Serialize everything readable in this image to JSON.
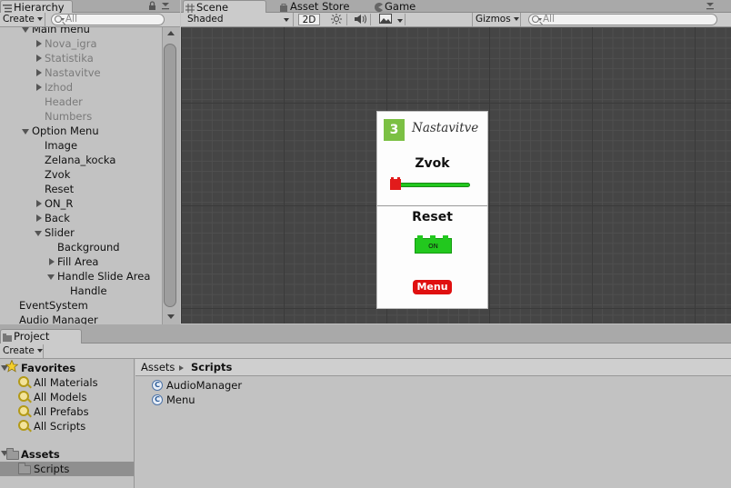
{
  "hierarchy": {
    "tab_label": "Hierarchy",
    "create_label": "Create",
    "search_placeholder": "All",
    "items": [
      {
        "label": "Main menu",
        "arrow": "down",
        "indent": 0,
        "dim": false
      },
      {
        "label": "Nova_igra",
        "arrow": "right",
        "indent": 1,
        "dim": true
      },
      {
        "label": "Statistika",
        "arrow": "right",
        "indent": 1,
        "dim": true
      },
      {
        "label": "Nastavitve",
        "arrow": "right",
        "indent": 1,
        "dim": true
      },
      {
        "label": "Izhod",
        "arrow": "right",
        "indent": 1,
        "dim": true
      },
      {
        "label": "Header",
        "arrow": "",
        "indent": 1,
        "dim": true
      },
      {
        "label": "Numbers",
        "arrow": "",
        "indent": 1,
        "dim": true
      },
      {
        "label": "Option Menu",
        "arrow": "down",
        "indent": 0,
        "dim": false
      },
      {
        "label": "Image",
        "arrow": "",
        "indent": 1,
        "dim": false
      },
      {
        "label": "Zelana_kocka",
        "arrow": "",
        "indent": 1,
        "dim": false
      },
      {
        "label": "Zvok",
        "arrow": "",
        "indent": 1,
        "dim": false
      },
      {
        "label": "Reset",
        "arrow": "",
        "indent": 1,
        "dim": false
      },
      {
        "label": "ON_R",
        "arrow": "right",
        "indent": 1,
        "dim": false
      },
      {
        "label": "Back",
        "arrow": "right",
        "indent": 1,
        "dim": false
      },
      {
        "label": "Slider",
        "arrow": "down",
        "indent": 1,
        "dim": false
      },
      {
        "label": "Background",
        "arrow": "",
        "indent": 2,
        "dim": false
      },
      {
        "label": "Fill Area",
        "arrow": "right",
        "indent": 2,
        "dim": false
      },
      {
        "label": "Handle Slide Area",
        "arrow": "down",
        "indent": 2,
        "dim": false
      },
      {
        "label": "Handle",
        "arrow": "",
        "indent": 3,
        "dim": false
      },
      {
        "label": "EventSystem",
        "arrow": "",
        "indent": -1,
        "dim": false
      },
      {
        "label": "Audio Manager",
        "arrow": "",
        "indent": -1,
        "dim": false
      }
    ]
  },
  "tabs": {
    "scene": "Scene",
    "asset_store": "Asset Store",
    "game": "Game"
  },
  "scene_toolbar": {
    "shading_mode": "Shaded",
    "mode_2d": "2D",
    "gizmos_label": "Gizmos",
    "search_placeholder": "All"
  },
  "game_canvas": {
    "logo_number": "3",
    "header_title": "Nastavitve",
    "sound_label": "Zvok",
    "reset_label": "Reset",
    "toggle_label": "ON",
    "menu_button": "Menu",
    "slider_value": 0.0
  },
  "project": {
    "tab_label": "Project",
    "create_label": "Create",
    "favorites_label": "Favorites",
    "favorites": [
      "All Materials",
      "All Models",
      "All Prefabs",
      "All Scripts"
    ],
    "assets_label": "Assets",
    "assets_children": [
      "Scripts"
    ],
    "breadcrumb": [
      "Assets",
      "Scripts"
    ],
    "files": [
      "AudioManager",
      "Menu"
    ]
  },
  "colors": {
    "accent_green": "#22c81e",
    "slider_red": "#e21b1b",
    "menu_red": "#e01010",
    "logo_green": "#7bc043",
    "selection": "#8f8f8f"
  }
}
